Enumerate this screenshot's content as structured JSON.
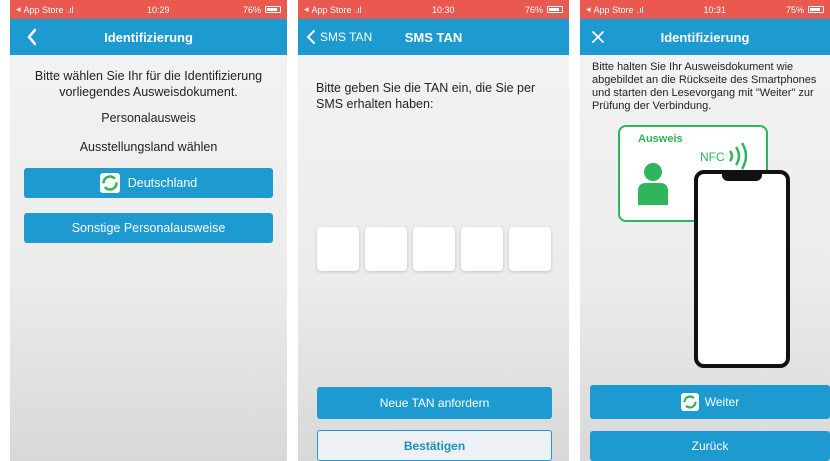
{
  "colors": {
    "accent": "#1d9bd1",
    "status_bar": "#e9594f",
    "green": "#2fb55b"
  },
  "screen1": {
    "status": {
      "left": "App Store",
      "time": "10:29",
      "battery": "76%"
    },
    "nav": {
      "title": "Identifizierung",
      "back_icon": "chevron-left-icon"
    },
    "intro": "Bitte wählen Sie Ihr für die Identifizierung vorliegendes Ausweisdokument.",
    "doc_type": "Personalausweis",
    "country_prompt": "Ausstellungsland wählen",
    "btn_country": "Deutschland",
    "btn_other": "Sonstige Personalausweise"
  },
  "screen2": {
    "status": {
      "left": "App Store",
      "time": "10:30",
      "battery": "76%"
    },
    "nav": {
      "title": "SMS TAN",
      "back_label": "SMS TAN"
    },
    "prompt": "Bitte geben Sie die TAN ein, die Sie per SMS erhalten haben:",
    "btn_new_tan": "Neue TAN anfordern",
    "btn_confirm": "Bestätigen"
  },
  "screen3": {
    "status": {
      "left": "App Store",
      "time": "10:31",
      "battery": "75%"
    },
    "nav": {
      "title": "Identifizierung",
      "close_icon": "close-icon"
    },
    "instructions": "Bitte halten Sie Ihr Ausweisdokument wie abgebildet an die Rückseite des Smartphones und starten den Lesevorgang mit \"Weiter\" zur Prüfung der Verbindung.",
    "card_label": "Ausweis",
    "nfc_label": "NFC",
    "btn_next": "Weiter",
    "btn_back": "Zurück"
  }
}
